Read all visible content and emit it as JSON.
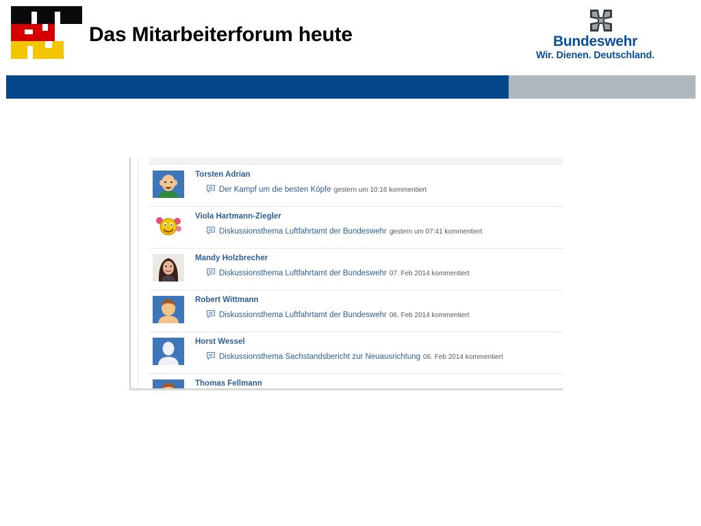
{
  "slide": {
    "title": "Das Mitarbeiterforum heute"
  },
  "brand": {
    "name": "Bundeswehr",
    "slogan": "Wir. Dienen. Deutschland.",
    "color": "#0a4f98",
    "band_blue": "#03478a",
    "band_grey": "#aeb7be"
  },
  "feed": {
    "entries": [
      {
        "name": "Torsten Adrian",
        "topic": "Der Kampf um die besten Köpfe",
        "meta": "gestern um 10:16 kommentiert",
        "avatar_icon": "bald-man-avatar-icon"
      },
      {
        "name": "Viola Hartmann-Ziegler",
        "topic": "Diskussionsthema Luftfahrtamt der Bundeswehr",
        "meta": "gestern um 07:41 kommentiert",
        "avatar_icon": "smiley-flowers-avatar-icon"
      },
      {
        "name": "Mandy Holzbrecher",
        "topic": "Diskussionsthema Luftfahrtamt der Bundeswehr",
        "meta": "07. Feb 2014 kommentiert",
        "avatar_icon": "woman-photo-avatar-icon"
      },
      {
        "name": "Robert Wittmann",
        "topic": "Diskussionsthema Luftfahrtamt der Bundeswehr",
        "meta": "06. Feb 2014 kommentiert",
        "avatar_icon": "man-avatar-icon"
      },
      {
        "name": "Horst Wessel",
        "topic": "Diskussionsthema Sachstandsbericht zur Neuausrichtung",
        "meta": "06. Feb 2014 kommentiert",
        "avatar_icon": "default-person-avatar-icon"
      },
      {
        "name": "Thomas Fellmann",
        "topic": "",
        "meta": "",
        "avatar_icon": "man-avatar-icon"
      }
    ]
  }
}
